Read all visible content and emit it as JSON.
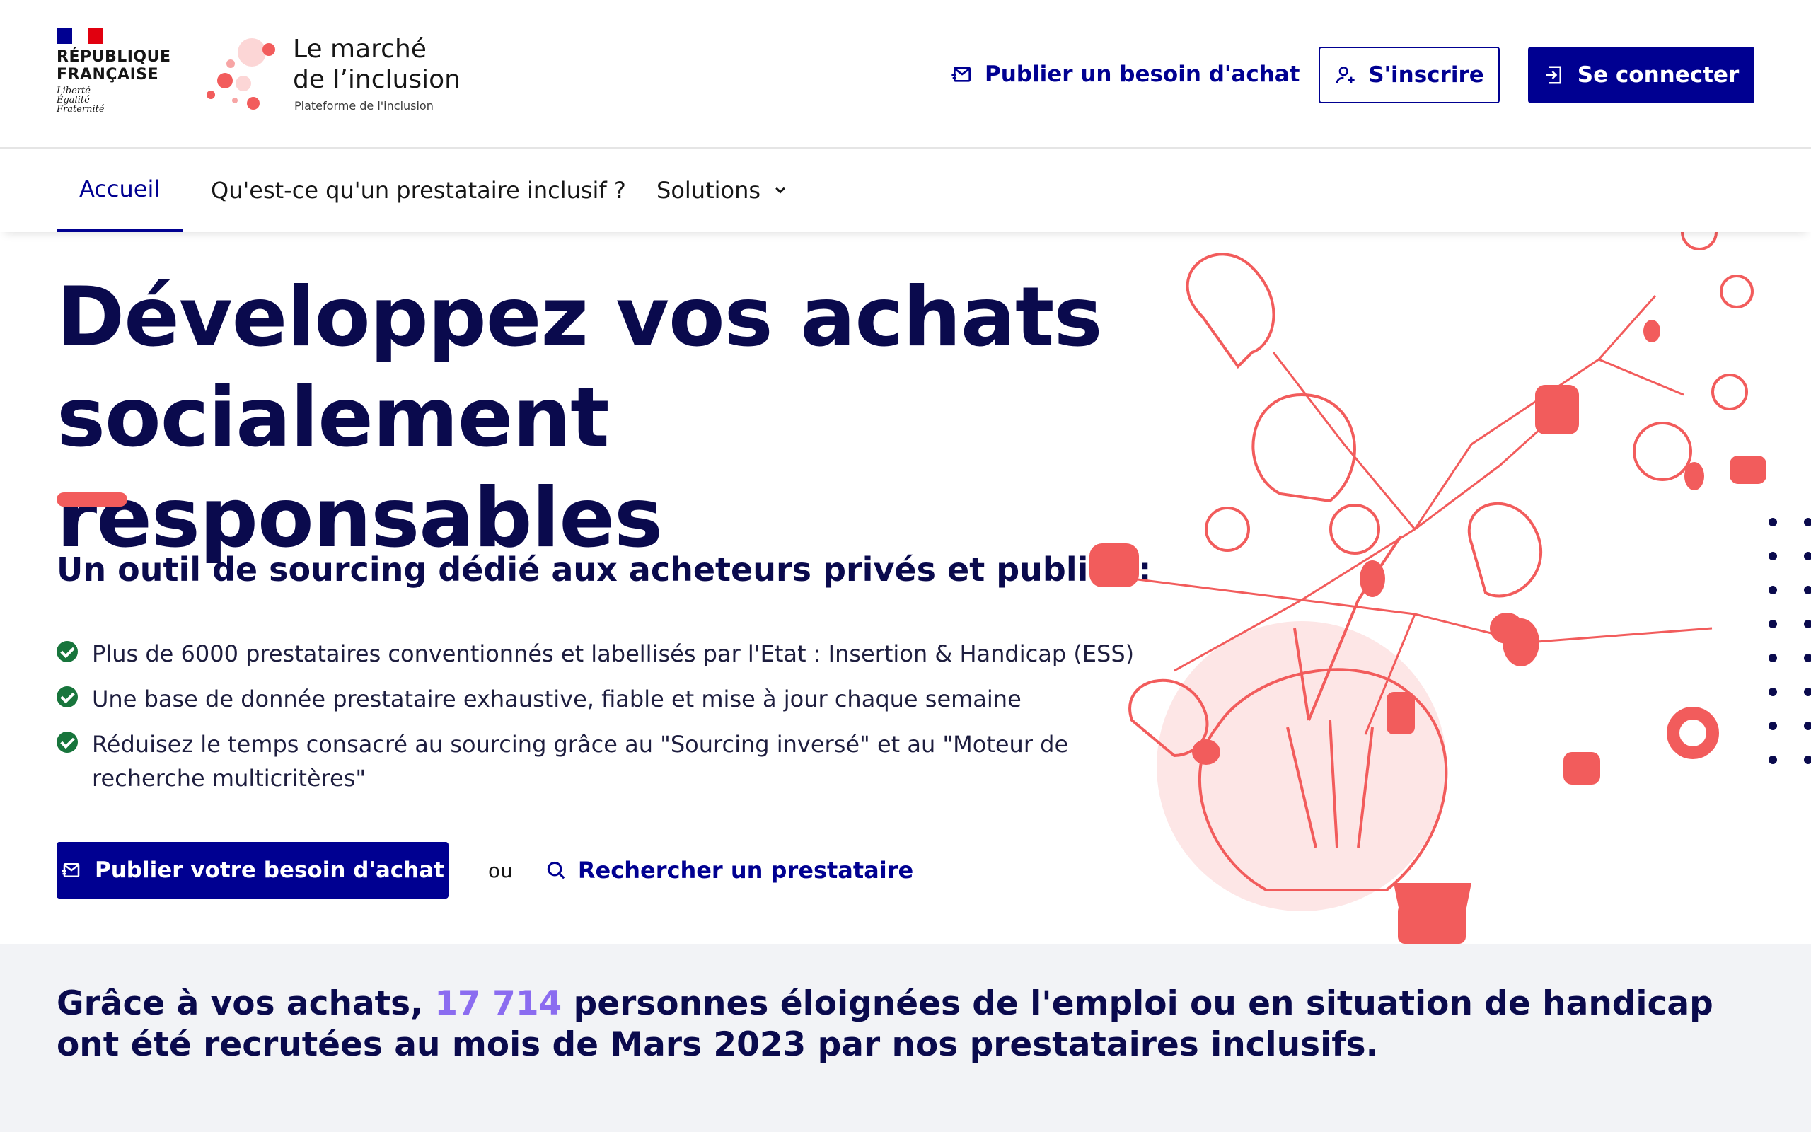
{
  "header": {
    "rf_title_line1": "RÉPUBLIQUE",
    "rf_title_line2": "FRANÇAISE",
    "rf_motto_1": "Liberté",
    "rf_motto_2": "Égalité",
    "rf_motto_3": "Fraternité",
    "brand_line1": "Le marché",
    "brand_line2": "de l’inclusion",
    "brand_sub": "Plateforme de l'inclusion",
    "publish_link": "Publier un besoin d'achat",
    "signup_label": "S'inscrire",
    "login_label": "Se connecter"
  },
  "nav": {
    "items": [
      {
        "label": "Accueil"
      },
      {
        "label": "Qu'est-ce qu'un prestataire inclusif ?"
      },
      {
        "label": "Solutions"
      }
    ]
  },
  "hero": {
    "title_line1": "Développez vos achats",
    "title_line2": "socialement responsables",
    "subtitle": "Un outil de sourcing dédié aux acheteurs privés et publics :",
    "bullets": [
      "Plus de 6000 prestataires conventionnés et labellisés par l'Etat : Insertion & Handicap (ESS)",
      "Une base de donnée prestataire exhaustive, fiable et mise à jour chaque semaine",
      "Réduisez le temps consacré au sourcing grâce au \"Sourcing inversé\" et au \"Moteur de recherche multicritères\""
    ],
    "cta_publish": "Publier votre besoin d'achat",
    "or_text": "ou",
    "cta_search": "Rechercher un prestataire"
  },
  "stats": {
    "prefix": "Grâce à vos achats,",
    "number": "17 714",
    "suffix": "personnes éloignées de l'emploi ou en situation de handicap ont été recrutées au mois de Mars 2023 par nos prestataires inclusifs."
  },
  "colors": {
    "primary": "#000091",
    "title": "#0a0a4d",
    "accent": "#f25c5c",
    "highlight": "#8b6cf0",
    "success": "#18753c",
    "band": "#f2f3f6"
  }
}
